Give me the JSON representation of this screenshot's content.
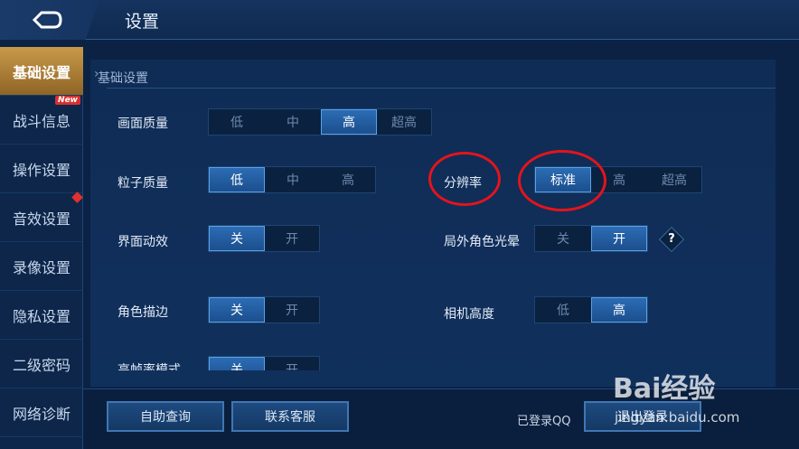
{
  "header": {
    "title": "设置"
  },
  "sidebar": {
    "items": [
      {
        "label": "基础设置",
        "active": true
      },
      {
        "label": "战斗信息",
        "badge": "New"
      },
      {
        "label": "操作设置",
        "dot": true
      },
      {
        "label": "音效设置"
      },
      {
        "label": "录像设置"
      },
      {
        "label": "隐私设置"
      },
      {
        "label": "二级密码"
      },
      {
        "label": "网络诊断"
      }
    ]
  },
  "section": {
    "title": "基础设置"
  },
  "settings": {
    "image_quality": {
      "label": "画面质量",
      "options": [
        "低",
        "中",
        "高",
        "超高"
      ],
      "selected": "高"
    },
    "particle_quality": {
      "label": "粒子质量",
      "options": [
        "低",
        "中",
        "高"
      ],
      "selected": "低"
    },
    "resolution": {
      "label": "分辨率",
      "options": [
        "标准",
        "高",
        "超高"
      ],
      "selected": "标准"
    },
    "ui_animation": {
      "label": "界面动效",
      "options": [
        "关",
        "开"
      ],
      "selected": "关"
    },
    "outside_glow": {
      "label": "局外角色光晕",
      "options": [
        "关",
        "开"
      ],
      "selected": "开",
      "help": "?"
    },
    "outline": {
      "label": "角色描边",
      "options": [
        "关",
        "开"
      ],
      "selected": "关"
    },
    "camera_height": {
      "label": "相机高度",
      "options": [
        "低",
        "高"
      ],
      "selected": "高"
    },
    "high_fps": {
      "label": "高帧率模式",
      "options": [
        "关",
        "开"
      ],
      "selected": "关"
    }
  },
  "footer": {
    "self_help": "自助查询",
    "contact": "联系客服",
    "login_status": "已登录QQ",
    "logout": "退出登录"
  },
  "watermark": {
    "brand": "Bai经验",
    "url": "jingyan.baidu.com"
  },
  "colors": {
    "accent": "#2c6cb4",
    "active_tab": "#c99a4a",
    "highlight_ring": "#e3141c"
  }
}
